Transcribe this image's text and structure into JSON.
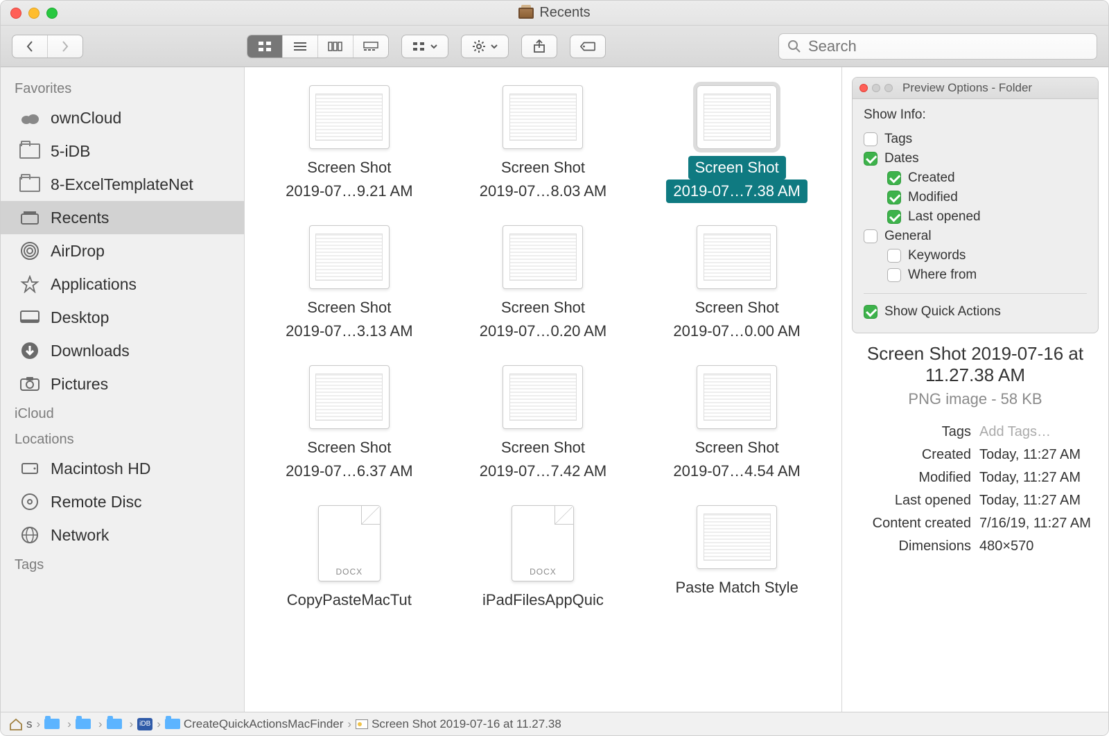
{
  "window": {
    "title": "Recents"
  },
  "toolbar": {
    "search_placeholder": "Search"
  },
  "sidebar": {
    "sections": {
      "favorites": {
        "title": "Favorites",
        "items": [
          {
            "label": "ownCloud"
          },
          {
            "label": "5-iDB"
          },
          {
            "label": "8-ExcelTemplateNet"
          },
          {
            "label": "Recents"
          },
          {
            "label": "AirDrop"
          },
          {
            "label": "Applications"
          },
          {
            "label": "Desktop"
          },
          {
            "label": "Downloads"
          },
          {
            "label": "Pictures"
          }
        ]
      },
      "icloud": {
        "title": "iCloud"
      },
      "locations": {
        "title": "Locations",
        "items": [
          {
            "label": "Macintosh HD"
          },
          {
            "label": "Remote Disc"
          },
          {
            "label": "Network"
          }
        ]
      },
      "tags": {
        "title": "Tags"
      }
    }
  },
  "files": [
    {
      "l1": "Screen Shot",
      "l2": "2019-07…9.21 AM",
      "type": "png"
    },
    {
      "l1": "Screen Shot",
      "l2": "2019-07…8.03 AM",
      "type": "png"
    },
    {
      "l1": "Screen Shot",
      "l2": "2019-07…7.38 AM",
      "type": "png"
    },
    {
      "l1": "Screen Shot",
      "l2": "2019-07…3.13 AM",
      "type": "png"
    },
    {
      "l1": "Screen Shot",
      "l2": "2019-07…0.20 AM",
      "type": "png"
    },
    {
      "l1": "Screen Shot",
      "l2": "2019-07…0.00 AM",
      "type": "png"
    },
    {
      "l1": "Screen Shot",
      "l2": "2019-07…6.37 AM",
      "type": "png"
    },
    {
      "l1": "Screen Shot",
      "l2": "2019-07…7.42 AM",
      "type": "png"
    },
    {
      "l1": "Screen Shot",
      "l2": "2019-07…4.54 AM",
      "type": "png"
    },
    {
      "l1": "CopyPasteMacTut",
      "l2": "",
      "type": "docx"
    },
    {
      "l1": "iPadFilesAppQuic",
      "l2": "",
      "type": "docx"
    },
    {
      "l1": "Paste Match Style",
      "l2": "",
      "type": "png"
    }
  ],
  "selected_index": 2,
  "preview_panel": {
    "title": "Preview Options - Folder",
    "heading": "Show Info:",
    "options": {
      "tags": "Tags",
      "dates": "Dates",
      "created": "Created",
      "modified": "Modified",
      "last_opened": "Last opened",
      "general": "General",
      "keywords": "Keywords",
      "where_from": "Where from",
      "show_quick": "Show Quick Actions"
    }
  },
  "details": {
    "filename": "Screen Shot 2019-07-16 at 11.27.38 AM",
    "kind": "PNG image - 58 KB",
    "rows": {
      "tags_k": "Tags",
      "tags_v": "Add Tags…",
      "created_k": "Created",
      "created_v": "Today, 11:27 AM",
      "modified_k": "Modified",
      "modified_v": "Today, 11:27 AM",
      "opened_k": "Last opened",
      "opened_v": "Today, 11:27 AM",
      "cc_k": "Content created",
      "cc_v": "7/16/19, 11:27 AM",
      "dim_k": "Dimensions",
      "dim_v": "480×570"
    }
  },
  "pathbar": {
    "crumbs": [
      "s",
      "",
      "",
      "",
      "iDB",
      "CreateQuickActionsMacFinder",
      "Screen Shot 2019-07-16 at 11.27.38"
    ]
  }
}
